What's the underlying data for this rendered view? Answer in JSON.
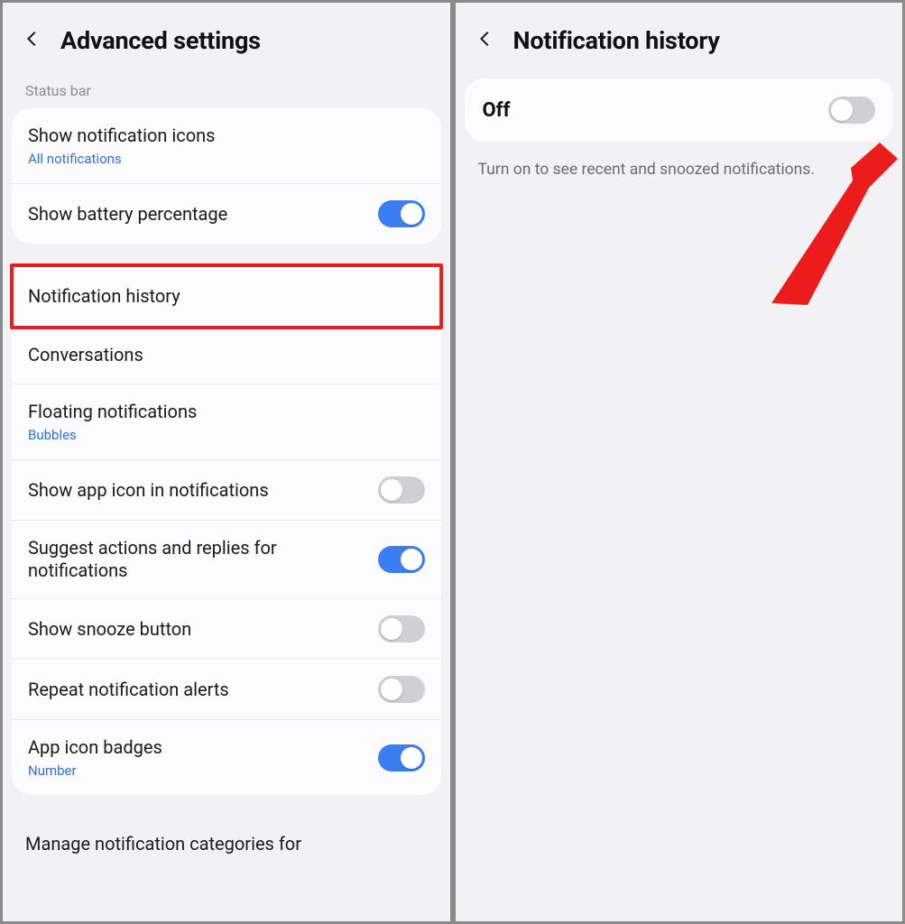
{
  "left": {
    "title": "Advanced settings",
    "section_status_bar": "Status bar",
    "rows": {
      "show_icons": {
        "title": "Show notification icons",
        "sub": "All notifications"
      },
      "battery": {
        "title": "Show battery percentage"
      },
      "history": {
        "title": "Notification history"
      },
      "convo": {
        "title": "Conversations"
      },
      "floating": {
        "title": "Floating notifications",
        "sub": "Bubbles"
      },
      "app_icon": {
        "title": "Show app icon in notifications"
      },
      "suggest": {
        "title": "Suggest actions and replies for notifications"
      },
      "snooze": {
        "title": "Show snooze button"
      },
      "repeat": {
        "title": "Repeat notification alerts"
      },
      "badges": {
        "title": "App icon badges",
        "sub": "Number"
      },
      "cutoff": "Manage notification categories for"
    },
    "toggles": {
      "battery": true,
      "app_icon": false,
      "suggest": true,
      "snooze": false,
      "repeat": false,
      "badges": true
    }
  },
  "right": {
    "title": "Notification history",
    "state_label": "Off",
    "hint": "Turn on to see recent and snoozed notifications.",
    "toggle": false
  }
}
